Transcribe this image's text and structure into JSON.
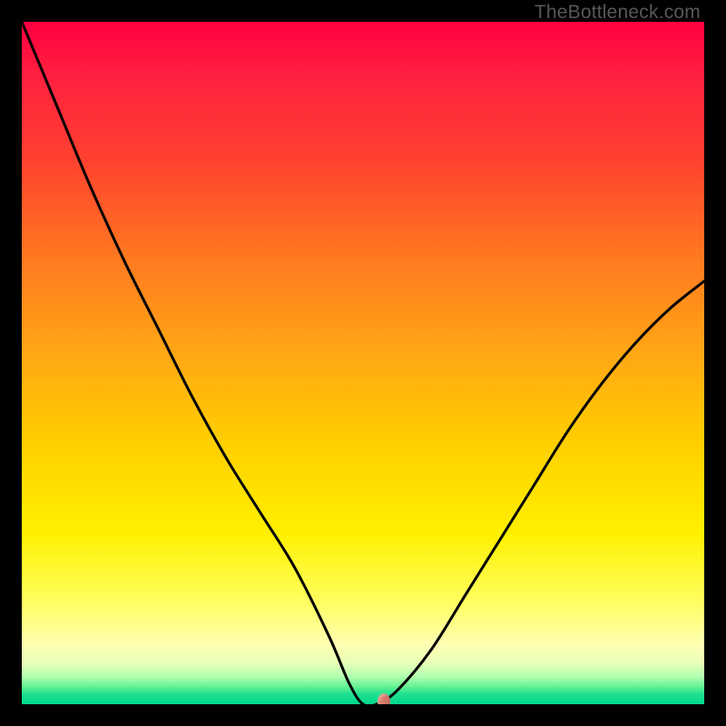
{
  "attribution": "TheBottleneck.com",
  "chart_data": {
    "type": "line",
    "title": "",
    "xlabel": "",
    "ylabel": "",
    "xlim": [
      0,
      100
    ],
    "ylim": [
      0,
      100
    ],
    "grid": false,
    "background": "red-to-green vertical gradient (red high, green low)",
    "x": [
      0,
      5,
      10,
      15,
      20,
      25,
      30,
      35,
      40,
      45,
      48,
      50,
      52,
      55,
      60,
      65,
      70,
      75,
      80,
      85,
      90,
      95,
      100
    ],
    "values": [
      100,
      88,
      76,
      65,
      55,
      45,
      36,
      28,
      20,
      10,
      3,
      0,
      0,
      2,
      8,
      16,
      24,
      32,
      40,
      47,
      53,
      58,
      62
    ],
    "marker": {
      "x": 53,
      "y": 0
    },
    "note": "Values are approximate percentages read from an unlabeled curve; 0 = bottom (green), 100 = top (red)."
  }
}
